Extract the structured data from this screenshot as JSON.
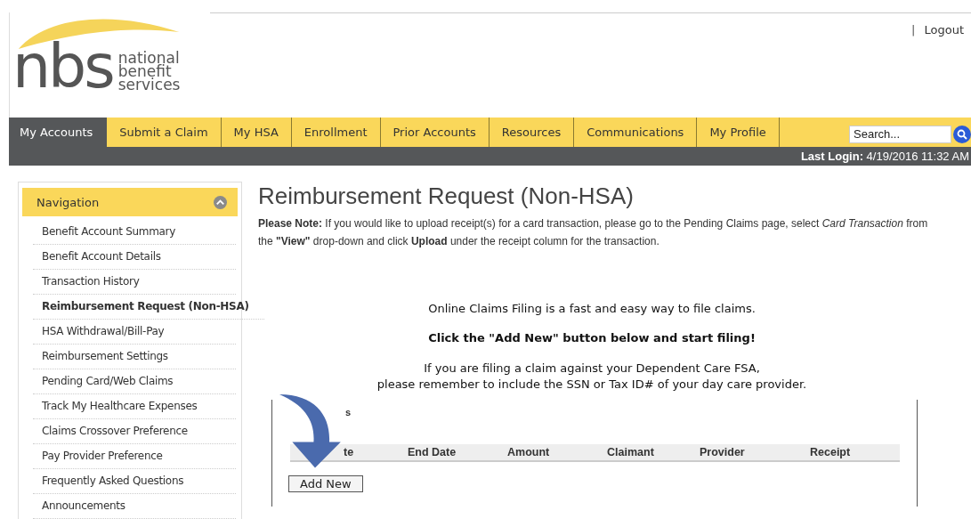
{
  "header": {
    "logo": {
      "mark": "nbs",
      "name_lines": [
        "national",
        "benefit",
        "services"
      ]
    },
    "separator": "|",
    "logout": "Logout"
  },
  "tabs": [
    {
      "label": "My Accounts",
      "selected": true
    },
    {
      "label": "Submit a Claim",
      "selected": false
    },
    {
      "label": "My HSA",
      "selected": false
    },
    {
      "label": "Enrollment",
      "selected": false
    },
    {
      "label": "Prior Accounts",
      "selected": false
    },
    {
      "label": "Resources",
      "selected": false
    },
    {
      "label": "Communications",
      "selected": false
    },
    {
      "label": "My Profile",
      "selected": false
    }
  ],
  "search": {
    "placeholder": "Search..."
  },
  "last_login": {
    "label": "Last Login:",
    "value": "4/19/2016 11:32 AM"
  },
  "sidebar": {
    "title": "Navigation",
    "expanded": true,
    "items": [
      {
        "label": "Benefit Account Summary",
        "selected": false
      },
      {
        "label": "Benefit Account Details",
        "selected": false
      },
      {
        "label": "Transaction History",
        "selected": false
      },
      {
        "label": "Reimbursement Request (Non-HSA)",
        "selected": true
      },
      {
        "label": "HSA Withdrawal/Bill-Pay",
        "selected": false
      },
      {
        "label": "Reimbursement Settings",
        "selected": false
      },
      {
        "label": "Pending Card/Web Claims",
        "selected": false
      },
      {
        "label": "Track My Healthcare Expenses",
        "selected": false
      },
      {
        "label": "Claims Crossover Preference",
        "selected": false
      },
      {
        "label": "Pay Provider Preference",
        "selected": false
      },
      {
        "label": "Frequently Asked Questions",
        "selected": false
      },
      {
        "label": "Announcements",
        "selected": false
      }
    ]
  },
  "main": {
    "title": "Reimbursement Request (Non-HSA)",
    "note": "**Please Note:** If you would like to upload receipt(s) for a card transaction, please go to the Pending Claims page, select *Card Transaction* from the **\"View\"** drop-down and click **Upload** under the receipt column for the transaction.",
    "intro": "Online Claims Filing is a fast and easy way to file claims.",
    "call_to_action": "Click the \"Add New\" button below and start filing!",
    "reminder_lines": [
      "If you are filing a claim against your Dependent Care FSA,",
      "please remember to include the SSN or Tax ID# of your day care provider."
    ],
    "claims_panel": {
      "title": "s",
      "columns": [
        "te",
        "End Date",
        "Amount",
        "Claimant",
        "Provider",
        "Receipt"
      ],
      "button": "Add New"
    }
  }
}
